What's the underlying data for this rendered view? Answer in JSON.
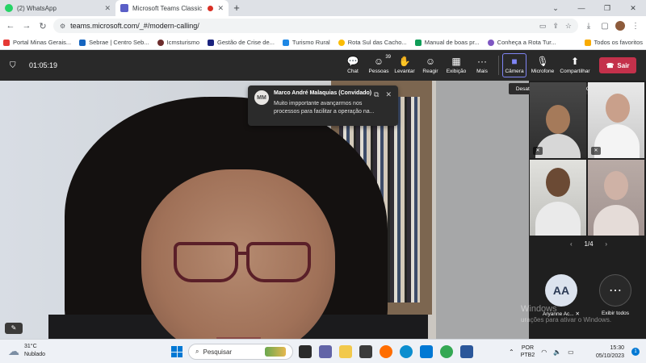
{
  "browser": {
    "tabs": [
      {
        "title": "(2) WhatsApp",
        "active": false,
        "color": "#25d366"
      },
      {
        "title": "Microsoft Teams Classic",
        "active": true,
        "color": "#5b5fc7"
      }
    ],
    "url": "teams.microsoft.com/_#/modern-calling/",
    "bookmarks": [
      {
        "label": "Portal Minas Gerais...",
        "color": "#e53935"
      },
      {
        "label": "Sebrae | Centro Seb...",
        "color": "#1565c0"
      },
      {
        "label": "Icmsturismo",
        "color": "#6d2d2d"
      },
      {
        "label": "Gestão de Crise de...",
        "color": "#1a237e"
      },
      {
        "label": "Turismo Rural",
        "color": "#1e88e5"
      },
      {
        "label": "Rota Sul das Cacho...",
        "color": "#fbbc04"
      },
      {
        "label": "Manual de boas pr...",
        "color": "#0f9d58"
      },
      {
        "label": "Conheça a Rota Tur...",
        "color": "#7e57c2"
      }
    ],
    "all_bookmarks": "Todos os favoritos"
  },
  "meeting": {
    "timer": "01:05:19",
    "controls": {
      "chat": "Chat",
      "people": "Pessoas",
      "people_count": "39",
      "raise": "Levantar",
      "react": "Reagir",
      "view": "Exibição",
      "more": "Mais",
      "camera": "Câmera",
      "mic": "Microfone",
      "share": "Compartilhar",
      "leave": "Sair"
    },
    "camera_tooltip": "Desativar Câmera (Ctrl+Shift+O)",
    "notification": {
      "initials": "MM",
      "sender": "Marco André Malaquias (Convidado)",
      "message": "Muito impportante avançarmos nos processos para facilitar a operação na..."
    },
    "page_indicator": "1/4",
    "participant_initials": "AA",
    "participant_name": "Aryanne Ac...",
    "show_all": "Exibir todos",
    "watermark_title": "Windows",
    "watermark_sub": "urações para ativar o Windows."
  },
  "taskbar": {
    "temperature": "31°C",
    "weather": "Nublado",
    "search_placeholder": "Pesquisar",
    "lang_1": "POR",
    "lang_2": "PTB2",
    "time": "15:30",
    "date": "05/10/2023",
    "notification_count": "1"
  }
}
